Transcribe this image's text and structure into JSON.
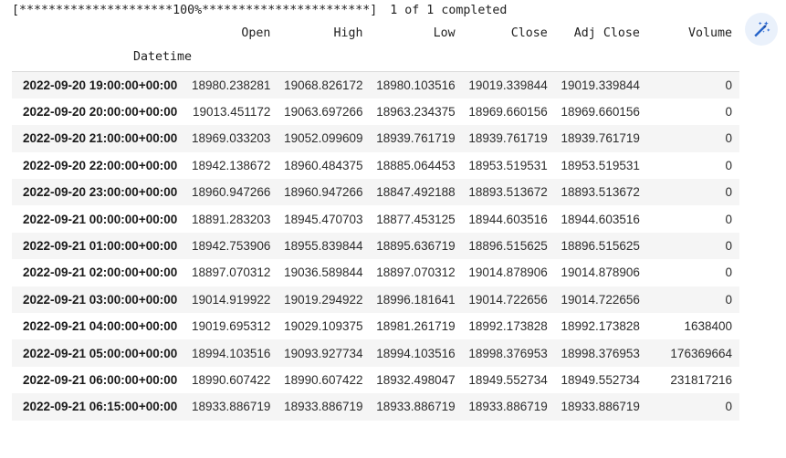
{
  "status_line": {
    "progress_bar": "[*********************100%***********************]",
    "status_text": "1 of 1 completed"
  },
  "wand_button": {
    "icon": "magic-wand-icon",
    "circle_color": "#eaf1fb",
    "icon_color": "#1a56c4"
  },
  "table": {
    "index_name": "Datetime",
    "columns": [
      "Open",
      "High",
      "Low",
      "Close",
      "Adj Close",
      "Volume"
    ],
    "rows": [
      {
        "index": "2022-09-20 19:00:00+00:00",
        "values": [
          "18980.238281",
          "19068.826172",
          "18980.103516",
          "19019.339844",
          "19019.339844",
          "0"
        ]
      },
      {
        "index": "2022-09-20 20:00:00+00:00",
        "values": [
          "19013.451172",
          "19063.697266",
          "18963.234375",
          "18969.660156",
          "18969.660156",
          "0"
        ]
      },
      {
        "index": "2022-09-20 21:00:00+00:00",
        "values": [
          "18969.033203",
          "19052.099609",
          "18939.761719",
          "18939.761719",
          "18939.761719",
          "0"
        ]
      },
      {
        "index": "2022-09-20 22:00:00+00:00",
        "values": [
          "18942.138672",
          "18960.484375",
          "18885.064453",
          "18953.519531",
          "18953.519531",
          "0"
        ]
      },
      {
        "index": "2022-09-20 23:00:00+00:00",
        "values": [
          "18960.947266",
          "18960.947266",
          "18847.492188",
          "18893.513672",
          "18893.513672",
          "0"
        ]
      },
      {
        "index": "2022-09-21 00:00:00+00:00",
        "values": [
          "18891.283203",
          "18945.470703",
          "18877.453125",
          "18944.603516",
          "18944.603516",
          "0"
        ]
      },
      {
        "index": "2022-09-21 01:00:00+00:00",
        "values": [
          "18942.753906",
          "18955.839844",
          "18895.636719",
          "18896.515625",
          "18896.515625",
          "0"
        ]
      },
      {
        "index": "2022-09-21 02:00:00+00:00",
        "values": [
          "18897.070312",
          "19036.589844",
          "18897.070312",
          "19014.878906",
          "19014.878906",
          "0"
        ]
      },
      {
        "index": "2022-09-21 03:00:00+00:00",
        "values": [
          "19014.919922",
          "19019.294922",
          "18996.181641",
          "19014.722656",
          "19014.722656",
          "0"
        ]
      },
      {
        "index": "2022-09-21 04:00:00+00:00",
        "values": [
          "19019.695312",
          "19029.109375",
          "18981.261719",
          "18992.173828",
          "18992.173828",
          "1638400"
        ]
      },
      {
        "index": "2022-09-21 05:00:00+00:00",
        "values": [
          "18994.103516",
          "19093.927734",
          "18994.103516",
          "18998.376953",
          "18998.376953",
          "176369664"
        ]
      },
      {
        "index": "2022-09-21 06:00:00+00:00",
        "values": [
          "18990.607422",
          "18990.607422",
          "18932.498047",
          "18949.552734",
          "18949.552734",
          "231817216"
        ]
      },
      {
        "index": "2022-09-21 06:15:00+00:00",
        "values": [
          "18933.886719",
          "18933.886719",
          "18933.886719",
          "18933.886719",
          "18933.886719",
          "0"
        ]
      }
    ]
  }
}
